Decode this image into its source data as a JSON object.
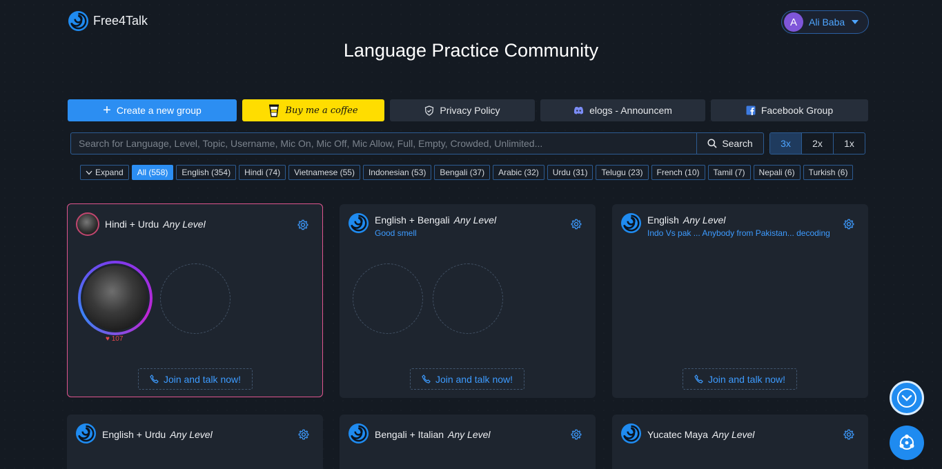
{
  "header": {
    "brand": "Free4Talk",
    "user": {
      "initial": "A",
      "name": "Ali Baba"
    }
  },
  "page_title": "Language Practice Community",
  "actions": {
    "create": "Create a new group",
    "coffee": "Buy me a coffee",
    "privacy": "Privacy Policy",
    "discord": "elogs - Announcem",
    "facebook": "Facebook Group"
  },
  "search": {
    "placeholder": "Search for Language, Level, Topic, Username, Mic On, Mic Off, Mic Allow, Full, Empty, Crowded, Unlimited...",
    "button": "Search"
  },
  "zoom": [
    "3x",
    "2x",
    "1x"
  ],
  "filters": {
    "expand": "Expand",
    "chips": [
      "All (558)",
      "English (354)",
      "Hindi (74)",
      "Vietnamese (55)",
      "Indonesian (53)",
      "Bengali (37)",
      "Arabic (32)",
      "Urdu (31)",
      "Telugu (23)",
      "French (10)",
      "Tamil (7)",
      "Nepali (6)",
      "Turkish (6)"
    ]
  },
  "cards": [
    {
      "title": "Hindi + Urdu",
      "level": "Any Level",
      "topic": "",
      "likes": "107",
      "join": "Join and talk now!"
    },
    {
      "title": "English + Bengali",
      "level": "Any Level",
      "topic": "Good smell",
      "join": "Join and talk now!"
    },
    {
      "title": "English",
      "level": "Any Level",
      "topic": "Indo Vs pak ... Anybody from Pakistan... decoding",
      "join": "Join and talk now!"
    },
    {
      "title": "English + Urdu",
      "level": "Any Level"
    },
    {
      "title": "Bengali + Italian",
      "level": "Any Level"
    },
    {
      "title": "Yucatec Maya",
      "level": "Any Level"
    }
  ],
  "colors": {
    "accent": "#2c8ef2",
    "coffee": "#ffdd00",
    "topic": "#3d9bff"
  }
}
